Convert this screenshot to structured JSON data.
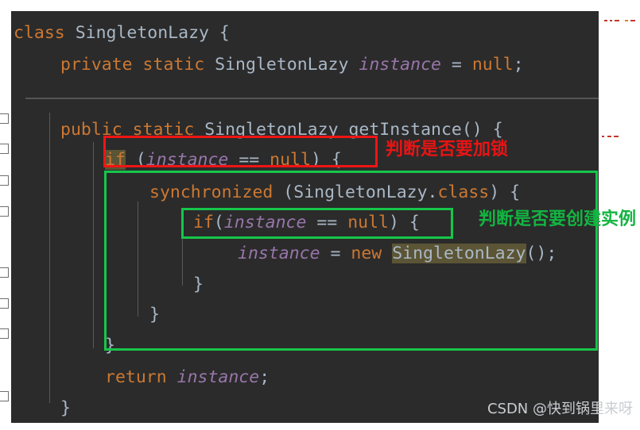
{
  "editor": {
    "theme_name": "darcula",
    "background_color": "#2b2b2b",
    "code_lines": [
      {
        "indent": 0,
        "text": "class SingletonLazy {"
      },
      {
        "indent": 1,
        "text": "private static SingletonLazy instance = null;"
      },
      {
        "indent": 1,
        "text": "public static SingletonLazy getInstance() {"
      },
      {
        "indent": 2,
        "text": "if (instance == null) {"
      },
      {
        "indent": 3,
        "text": "synchronized (SingletonLazy.class) {"
      },
      {
        "indent": 4,
        "text": "if(instance == null) {"
      },
      {
        "indent": 5,
        "text": "instance = new SingletonLazy();"
      },
      {
        "indent": 4,
        "text": "}"
      },
      {
        "indent": 3,
        "text": "}"
      },
      {
        "indent": 2,
        "text": "}"
      },
      {
        "indent": 2,
        "text": "return instance;"
      },
      {
        "indent": 1,
        "text": "}"
      }
    ],
    "tokens": {
      "line1": {
        "keyword": "class",
        "class_name": "SingletonLazy",
        "brace": "{"
      },
      "line2": {
        "modifiers": "private static",
        "type": "SingletonLazy",
        "field": "instance",
        "assign": "=",
        "value": "null",
        "semi": ";"
      },
      "line3": {
        "modifiers": "public static",
        "type": "SingletonLazy",
        "method": "getInstance()",
        "brace": "{"
      },
      "line4": {
        "keyword": "if",
        "open": "(",
        "field": "instance",
        "op": "==",
        "value": "null",
        "close": ")",
        "brace": "{"
      },
      "line5": {
        "keyword": "synchronized",
        "open": "(",
        "type": "SingletonLazy",
        "dot": ".",
        "class_kw": "class",
        "close": ")",
        "brace": "{"
      },
      "line6": {
        "keyword": "if",
        "open": "(",
        "field": "instance",
        "op": "==",
        "value": "null",
        "close": ")",
        "brace": "{"
      },
      "line7": {
        "field": "instance",
        "assign": "=",
        "keyword": "new",
        "type": "SingletonLazy",
        "parens": "()",
        "semi": ";"
      },
      "line11": {
        "keyword": "return",
        "field": "instance",
        "semi": ";"
      }
    },
    "highlighted_tokens": [
      "if",
      "SingletonLazy"
    ],
    "syntax_colors": {
      "keyword": "#cc7832",
      "type": "#a9b7c6",
      "field": "#9876aa",
      "punctuation": "#a9b7c6",
      "highlight_background": "#5b5535"
    }
  },
  "annotations": [
    {
      "id": "lock-check",
      "label": "判断是否要加锁",
      "color": "#e81414",
      "box_color": "#f01414",
      "target_line": "if (instance == null) {"
    },
    {
      "id": "create-instance-check",
      "label": "判断是否要创建实例",
      "color": "#13b441",
      "box_color": "#16c64a",
      "target_line": "if(instance == null) {"
    }
  ],
  "watermark": {
    "prefix": "CSDN @",
    "username": "快到锅里来呀",
    "full_text": "CSDN @快到锅里来呀"
  },
  "minimap_ticks": {
    "colors": [
      "#c0392b",
      "#d4861f"
    ],
    "count": 3
  }
}
